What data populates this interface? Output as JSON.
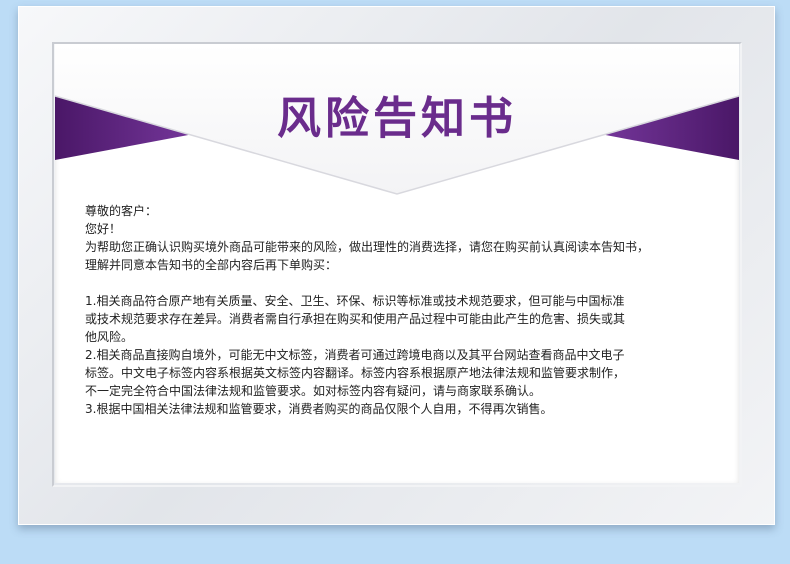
{
  "notice": {
    "title": "风险告知书",
    "greeting": "尊敬的客户：",
    "hello": "您好！",
    "intro_line1": "为帮助您正确认识购买境外商品可能带来的风险，做出理性的消费选择，请您在购买前认真阅读本告知书，",
    "intro_line2": "理解并同意本告知书的全部内容后再下单购买：",
    "item1_line1": "1.相关商品符合原产地有关质量、安全、卫生、环保、标识等标准或技术规范要求，但可能与中国标准",
    "item1_line2": "或技术规范要求存在差异。消费者需自行承担在购买和使用产品过程中可能由此产生的危害、损失或其",
    "item1_line3": "他风险。",
    "item2_line1": "2.相关商品直接购自境外，可能无中文标签，消费者可通过跨境电商以及其平台网站查看商品中文电子",
    "item2_line2": "标签。中文电子标签内容系根据英文标签内容翻译。标签内容系根据原产地法律法规和监管要求制作，",
    "item2_line3": "不一定完全符合中国法律法规和监管要求。如对标签内容有疑问，请与商家联系确认。",
    "item3_line1": "3.根据中国相关法律法规和监管要求，消费者购买的商品仅限个人自用，不得再次销售。"
  },
  "colors": {
    "background": "#bcdcf6",
    "title": "#6a2c8c",
    "ribbon_dark": "#4d1a6b",
    "ribbon_light": "#7a3aa0",
    "text": "#222222"
  }
}
